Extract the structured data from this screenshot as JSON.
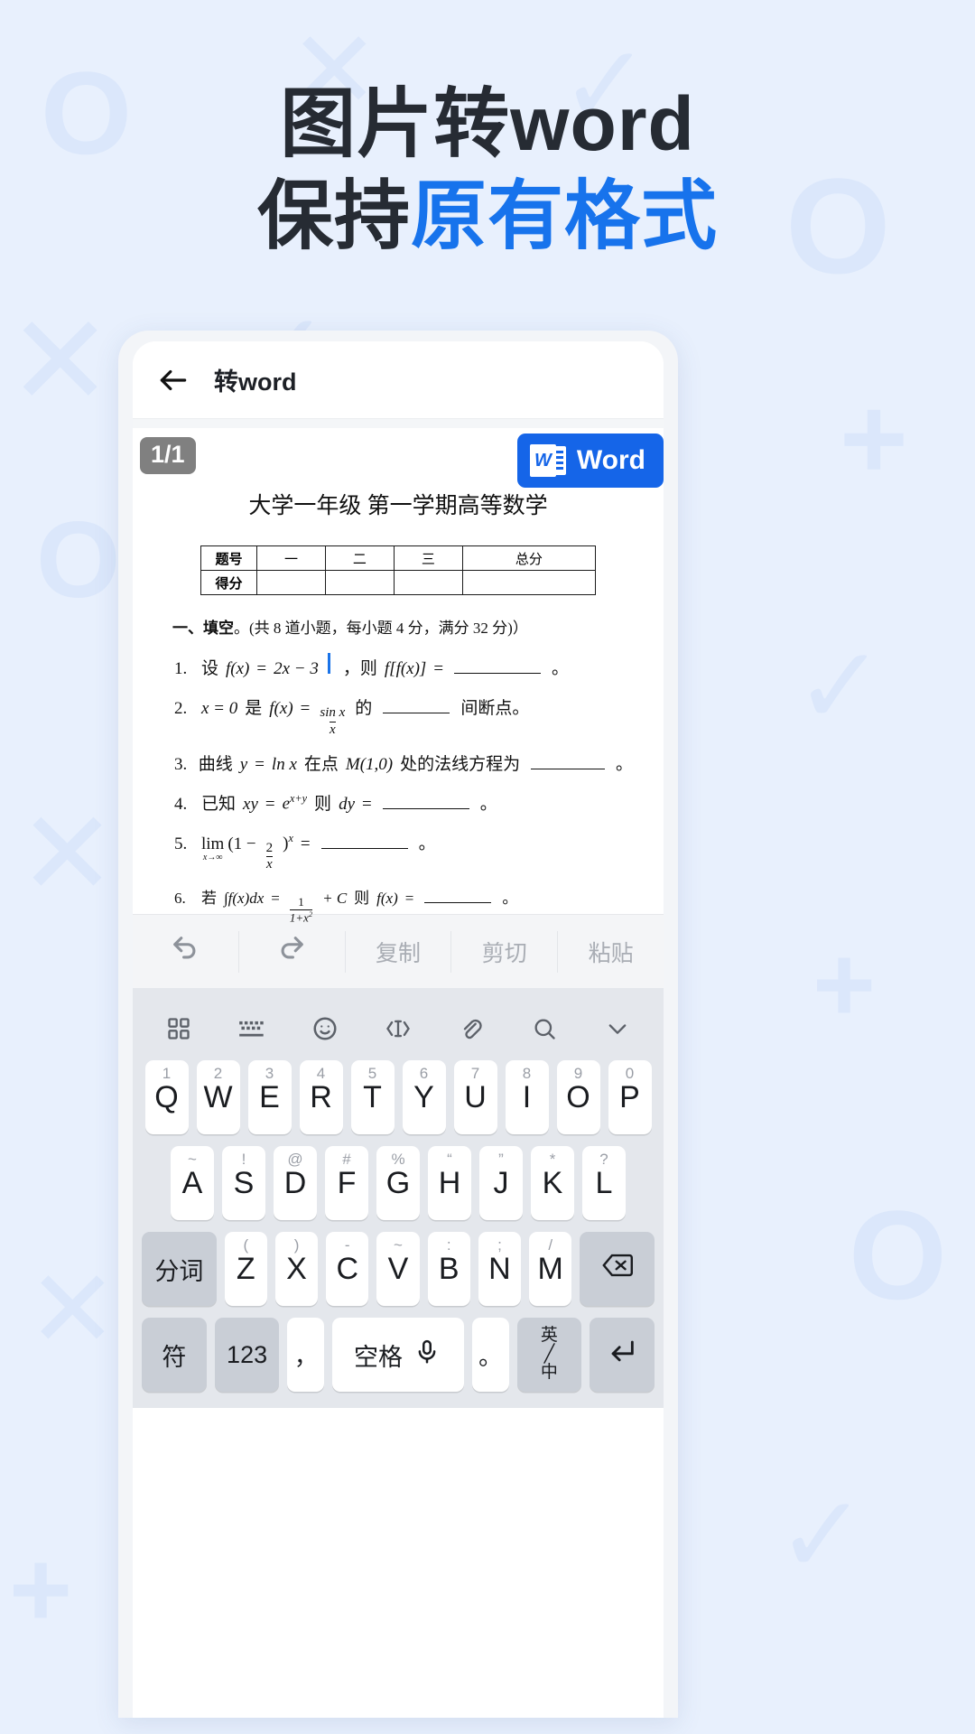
{
  "headline": {
    "line1": "图片转word",
    "line2_dark": "保持",
    "line2_blue": "原有格式"
  },
  "colors": {
    "background": "#e8f0fd",
    "accent_blue": "#1773ec",
    "headline_dark": "#262b33",
    "word_button": "#1565e8",
    "caret": "#1a73e8",
    "badge_gray": "#808080"
  },
  "appbar": {
    "back_icon": "arrow-left-icon",
    "title": "转word"
  },
  "document_viewer": {
    "page_badge": "1/1",
    "word_button": {
      "label": "Word",
      "icon": "word-file-icon"
    },
    "doc_title": "大学一年级 第一学期高等数学",
    "score_table": {
      "rows": [
        {
          "label": "题号",
          "cells": [
            "一",
            "二",
            "三",
            "总分"
          ]
        },
        {
          "label": "得分",
          "cells": [
            "",
            "",
            "",
            ""
          ]
        }
      ]
    },
    "section_heading": {
      "bold": "一、填空",
      "rest": "。(共 8 道小题，每小题 4 分，满分 32 分)）"
    },
    "questions": [
      {
        "num": "1.",
        "text": "设 f(x) = 2x − 3 | ，则 f[f(x)] = ______ 。"
      },
      {
        "num": "2.",
        "text": "x = 0 是 f(x) = sin x / x 的 ______ 间断点。"
      },
      {
        "num": "3.",
        "text": "曲线 y = ln x 在点 M(1,0) 处的法线方程为 ______ 。"
      },
      {
        "num": "4.",
        "text": "已知 xy = e^(x+y) 则 dy = ______ 。"
      },
      {
        "num": "5.",
        "text": "lim(x→∞)(1 − 2/x)^x = ______ 。"
      },
      {
        "num": "6.",
        "text": "若 ∫f(x)dx = 1/(1+x²) + C 则 f(x) = ______ 。"
      }
    ],
    "q1_parts": {
      "lead": "设",
      "fx": "f(x)",
      "eq": "=",
      "expr": "2x − 3",
      "comma": "，则",
      "fff": "f[f(x)]",
      "eq2": "=",
      "period": "。"
    },
    "q2_parts": {
      "x0": "x = 0",
      "shi": "是",
      "fx": "f(x)",
      "eq": "=",
      "num": "sin x",
      "den": "x",
      "de": "的",
      "tail": "间断点。"
    },
    "q3_parts": {
      "lead": "曲线",
      "y": "y",
      "eq": "=",
      "lnx": "ln x",
      "at": "在点",
      "M": "M(1,0)",
      "tail": "处的法线方程为",
      "period": "。"
    },
    "q4_parts": {
      "lead": "已知",
      "xy": "xy",
      "eq": "=",
      "e": "e",
      "exp": "x+y",
      "ze": "则",
      "dy": "dy",
      "eq2": "=",
      "period": "。"
    },
    "q5_parts": {
      "lim": "lim",
      "sub": "x→∞",
      "open": "(1 −",
      "num": "2",
      "den": "x",
      "close": ")",
      "sup": "x",
      "eq": "=",
      "period": "。"
    },
    "q6_parts": {
      "lead": "若",
      "int": "∫f(x)dx",
      "eq": "=",
      "num": "1",
      "den": "1+x",
      "den_sup": "2",
      "plusC": "+ C",
      "ze": "则",
      "fx": "f(x)",
      "eq2": "=",
      "period": "。"
    }
  },
  "edit_toolbar": {
    "items": [
      {
        "name": "undo",
        "label": "",
        "icon": "undo-icon"
      },
      {
        "name": "redo",
        "label": "",
        "icon": "redo-icon"
      },
      {
        "name": "copy",
        "label": "复制",
        "icon": ""
      },
      {
        "name": "cut",
        "label": "剪切",
        "icon": ""
      },
      {
        "name": "paste",
        "label": "粘贴",
        "icon": ""
      }
    ]
  },
  "keyboard": {
    "tool_icons": [
      "grid-icon",
      "keyboard-icon",
      "emoji-icon",
      "text-cursor-icon",
      "clip-icon",
      "search-icon",
      "chevron-down-icon"
    ],
    "row1": [
      {
        "alt": "1",
        "key": "Q"
      },
      {
        "alt": "2",
        "key": "W"
      },
      {
        "alt": "3",
        "key": "E"
      },
      {
        "alt": "4",
        "key": "R"
      },
      {
        "alt": "5",
        "key": "T"
      },
      {
        "alt": "6",
        "key": "Y"
      },
      {
        "alt": "7",
        "key": "U"
      },
      {
        "alt": "8",
        "key": "I"
      },
      {
        "alt": "9",
        "key": "O"
      },
      {
        "alt": "0",
        "key": "P"
      }
    ],
    "row2": [
      {
        "alt": "~",
        "key": "A"
      },
      {
        "alt": "!",
        "key": "S"
      },
      {
        "alt": "@",
        "key": "D"
      },
      {
        "alt": "#",
        "key": "F"
      },
      {
        "alt": "%",
        "key": "G"
      },
      {
        "alt": "“",
        "key": "H"
      },
      {
        "alt": "”",
        "key": "J"
      },
      {
        "alt": "*",
        "key": "K"
      },
      {
        "alt": "?",
        "key": "L"
      }
    ],
    "row3": {
      "left_key": "分词",
      "keys": [
        {
          "alt": "(",
          "key": "Z"
        },
        {
          "alt": ")",
          "key": "X"
        },
        {
          "alt": "-",
          "key": "C"
        },
        {
          "alt": "~",
          "key": "V"
        },
        {
          "alt": ":",
          "key": "B"
        },
        {
          "alt": ";",
          "key": "N"
        },
        {
          "alt": "/",
          "key": "M"
        }
      ],
      "right_key": "backspace-icon"
    },
    "row4": {
      "symbol": "符",
      "numeric": "123",
      "comma": "，",
      "space": "空格",
      "space_icon": "microphone-icon",
      "period": "。",
      "lang_top": "英",
      "lang_bottom": "中",
      "enter": "enter-icon"
    }
  }
}
